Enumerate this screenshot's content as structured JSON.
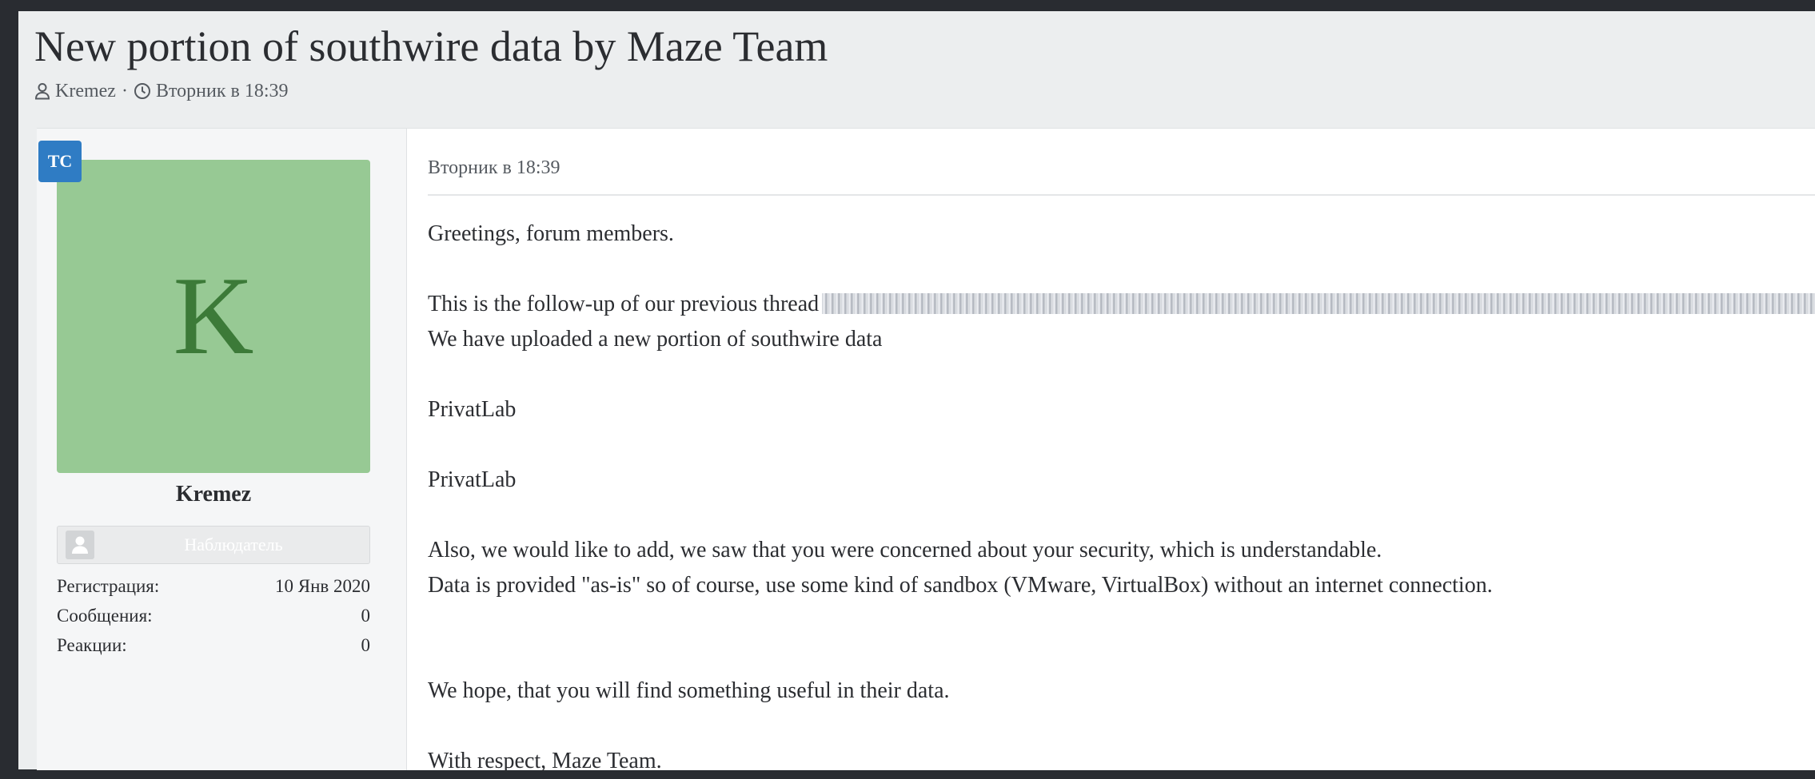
{
  "thread": {
    "title": "New portion of southwire data by Maze Team",
    "author": "Kremez",
    "separator": "·",
    "date": "Вторник в 18:39"
  },
  "user": {
    "badge": "TC",
    "avatar_letter": "K",
    "name": "Kremez",
    "role": "Наблюдатель",
    "stats": [
      {
        "label": "Регистрация:",
        "value": "10 Янв 2020"
      },
      {
        "label": "Сообщения:",
        "value": "0"
      },
      {
        "label": "Реакции:",
        "value": "0"
      }
    ]
  },
  "post": {
    "date": "Вторник в 18:39",
    "lines": {
      "greeting": "Greetings, forum members.",
      "followup": "This is the follow-up of our previous thread",
      "uploaded": "We have uploaded a new portion of southwire data",
      "link1": "PrivatLab",
      "link2": "PrivatLab",
      "security": "Also, we would like to add, we saw that you were concerned about your security, which is understandable.",
      "sandbox": "Data is provided \"as-is\" so of course, use some kind of sandbox (VMware, VirtualBox) without an internet connection.",
      "hope": "We hope, that you will find something useful in their data.",
      "signature": "With respect, Maze Team."
    }
  },
  "colors": {
    "avatar_bg": "#97c994",
    "avatar_letter": "#3c7a38",
    "badge_bg": "#2f7cc4",
    "page_bg": "#292c31"
  }
}
